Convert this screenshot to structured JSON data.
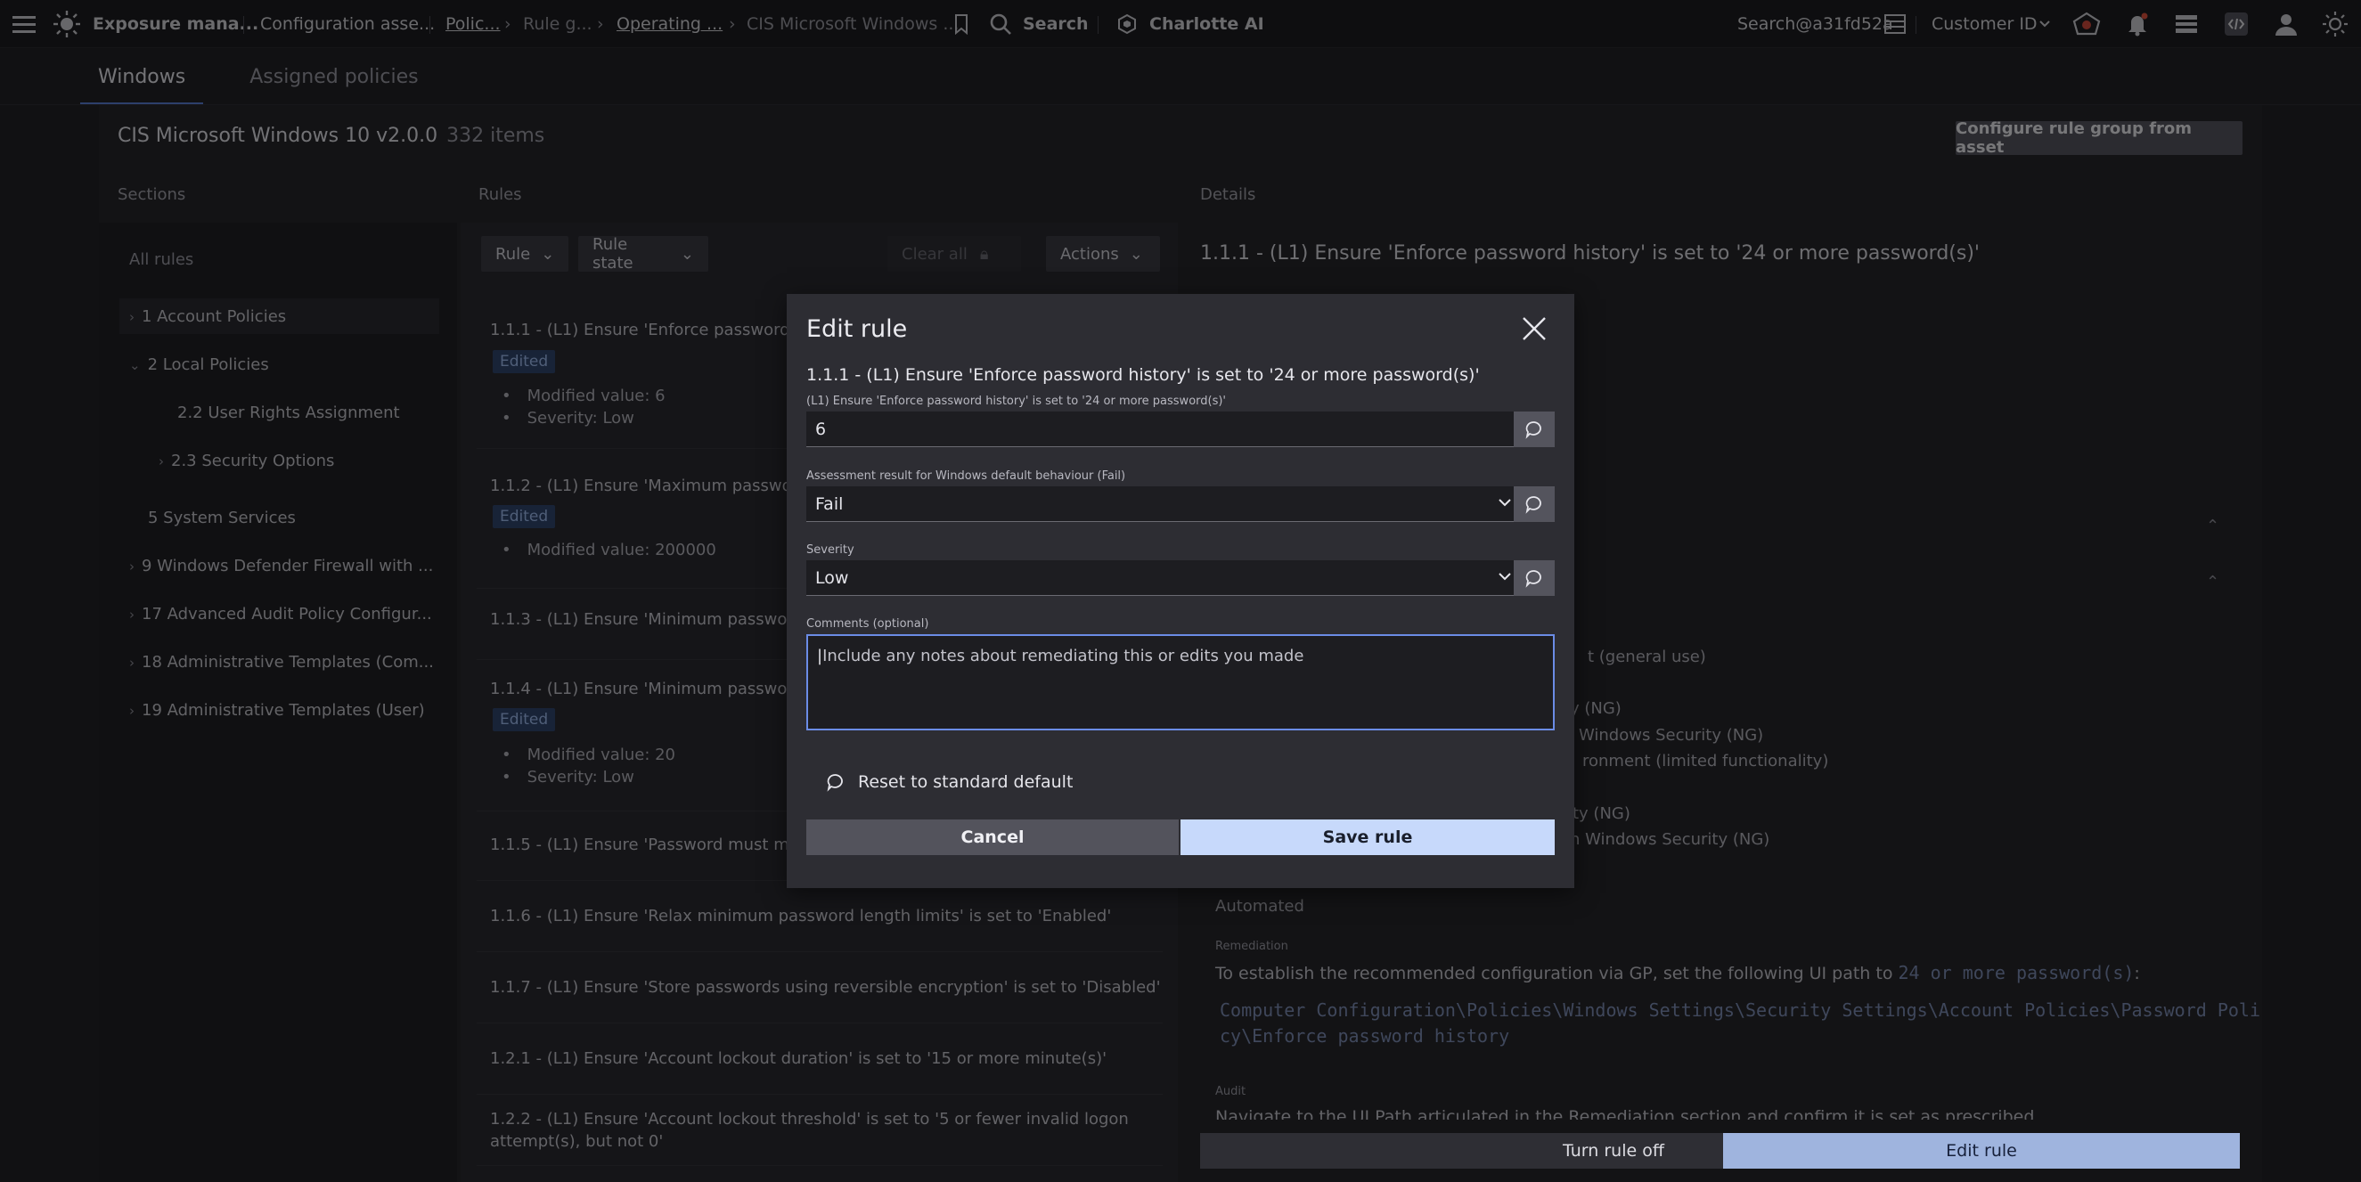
{
  "topbar": {
    "app_name": "Exposure mana...",
    "breadcrumbs": [
      "Configuration asse...",
      "Polic...",
      "Rule g...",
      "Operating ...",
      "CIS Microsoft Windows ..."
    ],
    "search_label": "Search",
    "ai_label": "Charlotte AI",
    "user_label": "Search@a31fd52a",
    "customer_label": "Customer ID"
  },
  "tabs": [
    {
      "label": "Windows",
      "active": true
    },
    {
      "label": "Assigned policies",
      "active": false
    }
  ],
  "page": {
    "title": "CIS Microsoft Windows 10 v2.0.0",
    "count": "332 items",
    "config_button": "Configure rule group from asset"
  },
  "columns": {
    "sections": "Sections",
    "rules": "Rules",
    "details": "Details"
  },
  "sections": {
    "all_rules": "All rules",
    "items": [
      "1 Account Policies",
      "2 Local Policies",
      "2.2 User Rights Assignment",
      "2.3 Security Options",
      "5 System Services",
      "9 Windows Defender Firewall with ...",
      "17 Advanced Audit Policy Configur...",
      "18 Administrative Templates (Com...",
      "19 Administrative Templates (User)"
    ]
  },
  "rules_toolbar": {
    "rule": "Rule",
    "rule_state": "Rule state",
    "clear_all": "Clear all",
    "actions": "Actions"
  },
  "rules": [
    {
      "title": "1.1.1 - (L1) Ensure 'Enforce password hist",
      "badge": "Edited",
      "bullets": [
        "Modified value: 6",
        "Severity: Low"
      ]
    },
    {
      "title": "1.1.2 - (L1) Ensure 'Maximum password a",
      "badge": "Edited",
      "bullets": [
        "Modified value: 200000"
      ]
    },
    {
      "title": "1.1.3 - (L1) Ensure 'Minimum password a"
    },
    {
      "title": "1.1.4 - (L1) Ensure 'Minimum password le",
      "badge": "Edited",
      "bullets": [
        "Modified value: 20",
        "Severity: Low"
      ]
    },
    {
      "title": "1.1.5 - (L1) Ensure 'Password must meet"
    },
    {
      "title": "1.1.6 - (L1) Ensure 'Relax minimum password length limits' is set to 'Enabled'"
    },
    {
      "title": "1.1.7 - (L1) Ensure 'Store passwords using reversible encryption' is set to 'Disabled'"
    },
    {
      "title": "1.2.1 - (L1) Ensure 'Account lockout duration' is set to '15 or more minute(s)'"
    },
    {
      "title": "1.2.2 - (L1) Ensure 'Account lockout threshold' is set to '5 or fewer invalid logon",
      "title2": "attempt(s), but not 0'"
    }
  ],
  "details": {
    "header": "1.1.1 - (L1) Ensure 'Enforce password history' is set to '24 or more password(s)'",
    "partial_lines": [
      "t (general use)",
      "y (NG)",
      "Windows Security (NG)",
      "ronment (limited functionality)",
      "ty (NG)",
      "n Windows Security (NG)"
    ],
    "automated": "Automated",
    "remediation_label": "Remediation",
    "remediation_text": "To establish the recommended configuration via GP, set the following UI path to",
    "remediation_value": "24 or more password(s)",
    "remediation_path_1": "Computer Configuration\\Policies\\Windows Settings\\Security Settings\\Account Policies\\Password Poli",
    "remediation_path_2": "cy\\Enforce password history",
    "audit_label": "Audit",
    "audit_text": "Navigate to the UI Path articulated in the Remediation section and confirm it is set as prescribed.",
    "turn_off": "Turn rule off",
    "edit_rule": "Edit rule"
  },
  "modal": {
    "title": "Edit rule",
    "rule_title": "1.1.1 - (L1) Ensure 'Enforce password history' is set to '24 or more password(s)'",
    "value_label": "(L1) Ensure 'Enforce password history' is set to '24 or more password(s)'",
    "value": "6",
    "assessment_label": "Assessment result for Windows default behaviour (Fail)",
    "assessment_value": "Fail",
    "severity_label": "Severity",
    "severity_value": "Low",
    "comments_label": "Comments (optional)",
    "comments_placeholder": "Include any notes about remediating this or edits you made",
    "reset": "Reset to standard default",
    "cancel": "Cancel",
    "save": "Save rule"
  }
}
